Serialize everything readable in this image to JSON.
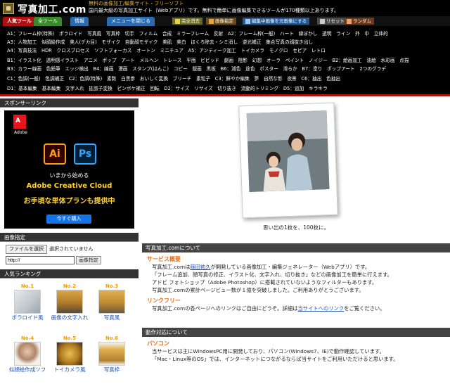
{
  "header": {
    "site_title": "写真加工.com",
    "tagline": "無料の画像加工/編集サイト・フリーソフト",
    "description": "国内最大級の写真加工サイト（Webアプリ）です。無料で簡単に画像編集できるツールが170種類以上あります。"
  },
  "tabs": {
    "popular": "人気ツール",
    "all": "全ツール",
    "info": "情報",
    "menu": "メニューを閉じる"
  },
  "mini_buttons": [
    {
      "label": "完全消去",
      "color": "#7a7a2a"
    },
    {
      "label": "画像指定",
      "color": "#7a5a1a"
    },
    {
      "label": "編集中画像を元画像にする",
      "color": "#2b6cb0"
    },
    {
      "label": "リセット",
      "color": "#5a5a5a"
    },
    {
      "label": "ランダム",
      "color": "#7a4a2a"
    }
  ],
  "tool_rows": [
    "A1：フレーム枠(特殊)　ポラロイド　写真風　写真枠　切手　フィルム　合成　ミラーフレーム　反射　A2：フレーム枠(一般)　ハート　縁ぼかし　透明　ライン　外　中　立体的",
    "A3：人物加工　似顔絵作成　美人(デカ目)　モザイク　自動顔モザイク　美肌　美白　ほくろ除去・シミ消し　逆光補正　集合写真の顔抜き出し",
    "A4：写真技法　HDR　クロスプロセス　ソフトフォーカス　オートン　ミニチュア　A5：アンティーク加工　トイカメラ　モノクロ　セピア　レトロ",
    "B1：イラスト化　透明感イラスト　アニメ　ポップ　アート　メルヘン　トレース　平面　ビビッド　劇画　陰影　幻想　オーラ　ペイント　ノイジー　B2：絵画加工　油絵　水彩画　点描",
    "B3：カラー線画　色鉛筆　エッジ検出　B4：線画　漫画　スタンプ(はんこ)　コピー　版画　黒板　B6：減色　途色　ポスター　滑らか　B7：塗り　ポップアート　2つのグラデ",
    "C1：色調(一般)　色調補正　C2：色調(特殊)　素数　白黒参　おいしく変換　ブリーチ　素粒子　C3：鮮やか編集　夢　自然な影　夜景　C6：抽出　色抽出",
    "D1：基本編集　基本編集　文字入れ　拡張子変換　ピンボケ補正　回転　D2：サイズ　リサイズ　切り抜き　流動的トリミング　D5：追加　キラキラ"
  ],
  "sidebar": {
    "sponsor_head": "スポンサーリンク",
    "ad": {
      "brand": "Adobe",
      "ai": "Ai",
      "ps": "Ps",
      "line1": "いまから始める",
      "line2": "Adobe Creative Cloud",
      "line3": "お手頃な単体プランも提供中",
      "button": "今すぐ購入"
    },
    "image_spec_head": "画像指定",
    "file_button": "ファイルを選択",
    "file_status": "選択されていません",
    "url_value": "http://",
    "url_button": "画像指定",
    "ranking_head": "人気ランキング",
    "ranking": [
      {
        "no": "No.1",
        "label": "ポラロイド風"
      },
      {
        "no": "No.2",
        "label": "画像の文字入れ"
      },
      {
        "no": "No.3",
        "label": "写真風"
      },
      {
        "no": "No.4",
        "label": "似顔絵作成ソフ"
      },
      {
        "no": "No.5",
        "label": "トイカメラ風"
      },
      {
        "no": "No.6",
        "label": "写真枠"
      }
    ]
  },
  "main": {
    "caption": "思い出の1枚を、100枚に。",
    "about_head": "写真加工.comについて",
    "service_title": "サービス概要",
    "service_lines": {
      "l1a": "写真加工.comは",
      "l1link": "篠田祐久",
      "l1b": "が開発している画像加工・編集ジェネレーター（Webアプリ）です。",
      "l2": "「フレーム追加、顔写真の修正、イラスト化、文字入れ、切り抜き」などの画像加工を簡単に行えます。",
      "l3": "アドビ フォトショップ（Adobe Photoshop）に搭載されていないようなフィルターもあります。",
      "l4": "写真加工.comの累計ページビュー数が１億を突破しました。ご利用ありがとうございます。"
    },
    "link_title": "リンクフリー",
    "link_line": {
      "a": "写真加工.comの各ページへのリンクはご自由にどうぞ。詳細は",
      "link": "当サイトへのリンク",
      "b": "をご覧ください。"
    },
    "compat_head": "動作対応について",
    "pc_title": "パソコン",
    "pc_lines": {
      "l1": "当サービスは主にWindowsPC用に開発しており、パソコン(Windows7、IE)で動作確認しています。",
      "l2": "「Mac・Linux等のOS」では、インターネットにつながるならば当サイトをご利用いただけると思います。"
    }
  }
}
